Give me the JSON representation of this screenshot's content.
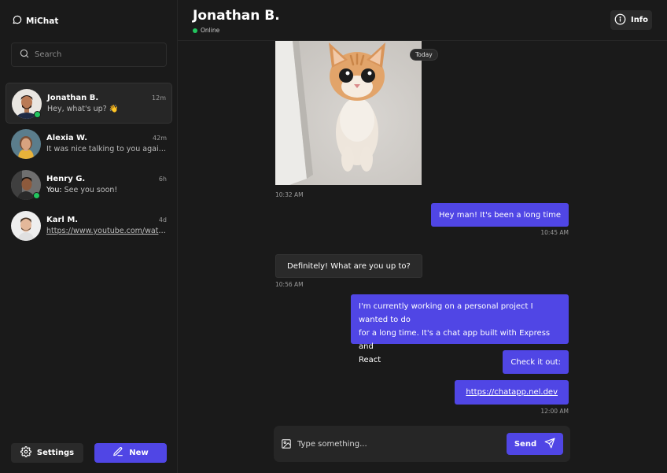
{
  "app": {
    "name": "MiChat"
  },
  "search": {
    "placeholder": "Search"
  },
  "conversations": [
    {
      "name": "Jonathan B.",
      "time": "12m",
      "preview": "Hey, what's up? 👋",
      "online": true,
      "active": true
    },
    {
      "name": "Alexia W.",
      "time": "42m",
      "preview": "It was nice talking to you again...",
      "online": false,
      "active": false
    },
    {
      "name": "Henry G.",
      "time": "6h",
      "preview_prefix": "You:",
      "preview": "See you soon!",
      "online": true,
      "active": false
    },
    {
      "name": "Karl M.",
      "time": "4d",
      "preview": "https://www.youtube.com/watch...",
      "online": false,
      "active": false
    }
  ],
  "footer": {
    "settings_label": "Settings",
    "new_label": "New"
  },
  "chat": {
    "title": "Jonathan B.",
    "status": "Online",
    "info_label": "Info",
    "date_divider": "Today",
    "messages": [
      {
        "direction": "in",
        "type": "image",
        "time": "10:32 AM"
      },
      {
        "direction": "out",
        "text": "Hey man! It's been a long time",
        "time": "10:45 AM"
      },
      {
        "direction": "in",
        "text": "Definitely! What are you up to?",
        "time": "10:56 AM"
      },
      {
        "direction": "out",
        "lines": [
          "I'm currently working on a personal project I wanted to do",
          "for a long time. It's a chat app built with Express and",
          "React"
        ]
      },
      {
        "direction": "out",
        "text": "Check it out:"
      },
      {
        "direction": "out",
        "text": "https://chatapp.nel.dev",
        "link": true,
        "time": "12:00 AM"
      }
    ]
  },
  "composer": {
    "placeholder": "Type something...",
    "send_label": "Send"
  },
  "colors": {
    "accent": "#5046e5",
    "online": "#22c55e",
    "background": "#1a1a1a",
    "surface": "#2a2a2a"
  }
}
